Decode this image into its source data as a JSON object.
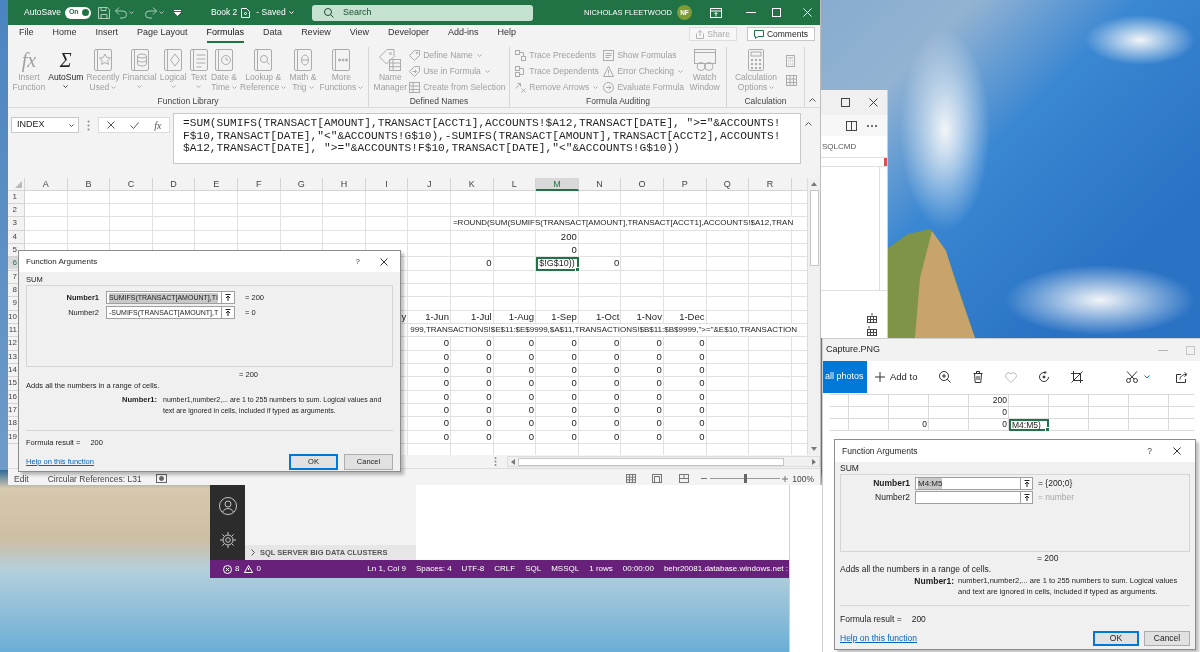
{
  "excel": {
    "title_bar": {
      "autosave_label": "AutoSave",
      "autosave_toggle": {
        "label": "On",
        "on": true
      },
      "document": "Book 2",
      "save_status": "- Saved",
      "search": {
        "placeholder": "Search"
      },
      "user_name": "NICHOLAS FLEETWOOD",
      "user_initials": "NF"
    },
    "tabs": [
      {
        "label": "File",
        "selected": false
      },
      {
        "label": "Home",
        "selected": false
      },
      {
        "label": "Insert",
        "selected": false
      },
      {
        "label": "Page Layout",
        "selected": false
      },
      {
        "label": "Formulas",
        "selected": true
      },
      {
        "label": "Data",
        "selected": false
      },
      {
        "label": "Review",
        "selected": false
      },
      {
        "label": "View",
        "selected": false
      },
      {
        "label": "Developer",
        "selected": false
      },
      {
        "label": "Add-ins",
        "selected": false
      },
      {
        "label": "Help",
        "selected": false
      }
    ],
    "share_button": {
      "label": "Share",
      "disabled": true
    },
    "comments_button": {
      "label": "Comments",
      "disabled": false
    },
    "ribbon_groups": [
      {
        "label": "Function Library",
        "commands": [
          {
            "kind": "large",
            "glyph": "fx",
            "label": "Insert\nFunction",
            "disabled": true,
            "dropdown": false
          },
          {
            "kind": "large",
            "glyph": "Σ",
            "label": "AutoSum",
            "disabled": false,
            "dropdown": true
          },
          {
            "kind": "large",
            "label": "Recently\nUsed",
            "disabled": true,
            "dropdown": true
          },
          {
            "kind": "large",
            "label": "Financial",
            "disabled": true,
            "dropdown": true
          },
          {
            "kind": "large",
            "label": "Logical",
            "disabled": true,
            "dropdown": true
          },
          {
            "kind": "large",
            "label": "Text",
            "disabled": true,
            "dropdown": true
          },
          {
            "kind": "large",
            "label": "Date &\nTime",
            "disabled": true,
            "dropdown": true
          },
          {
            "kind": "large",
            "label": "Lookup &\nReference",
            "disabled": true,
            "dropdown": true
          },
          {
            "kind": "large",
            "label": "Math &\nTrig",
            "disabled": true,
            "dropdown": true
          },
          {
            "kind": "large",
            "label": "More\nFunctions",
            "disabled": true,
            "dropdown": true
          }
        ]
      },
      {
        "label": "Defined Names",
        "commands": [
          {
            "kind": "large",
            "label": "Name\nManager",
            "disabled": true,
            "dropdown": false
          },
          {
            "kind": "small",
            "label": "Define Name",
            "disabled": true,
            "dropdown": true
          },
          {
            "kind": "small",
            "label": "Use in Formula",
            "disabled": true,
            "dropdown": true
          },
          {
            "kind": "small",
            "label": "Create from Selection",
            "disabled": true,
            "dropdown": false
          }
        ]
      },
      {
        "label": "Formula Auditing",
        "commands": [
          {
            "kind": "small",
            "label": "Trace Precedents",
            "disabled": true,
            "dropdown": false
          },
          {
            "kind": "small",
            "label": "Trace Dependents",
            "disabled": true,
            "dropdown": false
          },
          {
            "kind": "small",
            "label": "Remove Arrows",
            "disabled": true,
            "dropdown": true
          },
          {
            "kind": "small",
            "label": "Show Formulas",
            "disabled": true,
            "dropdown": false
          },
          {
            "kind": "small",
            "label": "Error Checking",
            "disabled": true,
            "dropdown": true
          },
          {
            "kind": "small",
            "label": "Evaluate Formula",
            "disabled": true,
            "dropdown": false
          },
          {
            "kind": "large",
            "label": "Watch\nWindow",
            "disabled": true,
            "dropdown": false
          }
        ]
      },
      {
        "label": "Calculation",
        "commands": [
          {
            "kind": "large",
            "label": "Calculation\nOptions",
            "disabled": true,
            "dropdown": true
          },
          {
            "kind": "icon",
            "disabled": true
          },
          {
            "kind": "icon",
            "disabled": true
          }
        ]
      }
    ],
    "formula_bar": {
      "name_box": "INDEX",
      "function_glyph": "fx",
      "formula_lines": [
        "=SUM(SUMIFS(TRANSACT[AMOUNT],TRANSACT[ACCT1],ACCOUNTS!$A12,TRANSACT[DATE], \">=\"&ACCOUNTS!",
        "F$10,TRANSACT[DATE],\"<\"&ACCOUNTS!G$10),-SUMIFS(TRANSACT[AMOUNT],TRANSACT[ACCT2],ACCOUNTS!",
        "$A12,TRANSACT[DATE], \">=\"&ACCOUNTS!F$10,TRANSACT[DATE],\"<\"&ACCOUNTS!G$10))"
      ]
    },
    "grid": {
      "columns": [
        "A",
        "B",
        "C",
        "D",
        "E",
        "F",
        "G",
        "H",
        "I",
        "J",
        "K",
        "L",
        "M",
        "N",
        "O",
        "P",
        "Q",
        "R"
      ],
      "rows": [
        {
          "header": "1"
        },
        {
          "header": "2"
        },
        {
          "header": "3",
          "cells": [
            null,
            null,
            null,
            null,
            null,
            null,
            null,
            null,
            null,
            null,
            {
              "kind": "text",
              "text": "=ROUND(SUM(SUMIFS(TRANSACT[AMOUNT],TRANSACT[ACCT1],ACCOUNTS!$A12,TRAN",
              "selected": false
            },
            null,
            null,
            null,
            null,
            null,
            null,
            null
          ]
        },
        {
          "header": "4",
          "cells": [
            null,
            null,
            null,
            null,
            null,
            null,
            null,
            null,
            null,
            null,
            null,
            null,
            {
              "kind": "number",
              "text": "200",
              "selected": false
            },
            null,
            null,
            null,
            null,
            null
          ]
        },
        {
          "header": "5",
          "cells": [
            null,
            null,
            null,
            null,
            null,
            null,
            null,
            null,
            null,
            null,
            null,
            null,
            {
              "kind": "number",
              "text": "0",
              "selected": false
            },
            null,
            null,
            null,
            null,
            null
          ]
        },
        {
          "header": "6",
          "cells": [
            null,
            null,
            null,
            null,
            null,
            null,
            null,
            null,
            null,
            null,
            {
              "kind": "number",
              "text": "0",
              "selected": false
            },
            null,
            {
              "kind": "text",
              "text": "$!G$10))",
              "selected": true
            },
            {
              "kind": "number",
              "text": "0",
              "selected": false
            },
            null,
            null,
            null,
            null
          ]
        },
        {
          "header": "7"
        },
        {
          "header": "8"
        },
        {
          "header": "9"
        },
        {
          "header": "10",
          "cells": [
            null,
            null,
            null,
            null,
            null,
            null,
            null,
            null,
            {
              "kind": "number",
              "text": "y",
              "selected": false
            },
            {
              "kind": "number",
              "text": "1-Jun",
              "selected": false
            },
            {
              "kind": "number",
              "text": "1-Jul",
              "selected": false
            },
            {
              "kind": "number",
              "text": "1-Aug",
              "selected": false
            },
            {
              "kind": "number",
              "text": "1-Sep",
              "selected": false
            },
            {
              "kind": "number",
              "text": "1-Oct",
              "selected": false
            },
            {
              "kind": "number",
              "text": "1-Nov",
              "selected": false
            },
            {
              "kind": "number",
              "text": "1-Dec",
              "selected": false
            },
            null,
            null
          ]
        },
        {
          "header": "11",
          "cells": [
            null,
            null,
            null,
            null,
            null,
            null,
            null,
            null,
            null,
            {
              "kind": "text",
              "text": "999,TRANSACTIONS!$E$11:$E$9999,$A$11,TRANSACTIONS!$B$11:$B$9999,\">=\"&E$10,TRANSACTION",
              "selected": false
            },
            null,
            null,
            null,
            null,
            null,
            null,
            null,
            null
          ]
        },
        {
          "header": "12",
          "cells": [
            null,
            null,
            null,
            null,
            null,
            null,
            null,
            null,
            null,
            {
              "kind": "number",
              "text": "0",
              "selected": false
            },
            {
              "kind": "number",
              "text": "0",
              "selected": false
            },
            {
              "kind": "number",
              "text": "0",
              "selected": false
            },
            {
              "kind": "number",
              "text": "0",
              "selected": false
            },
            {
              "kind": "number",
              "text": "0",
              "selected": false
            },
            {
              "kind": "number",
              "text": "0",
              "selected": false
            },
            {
              "kind": "number",
              "text": "0",
              "selected": false
            },
            null,
            null
          ]
        },
        {
          "header": "13",
          "cells": [
            null,
            null,
            null,
            null,
            null,
            null,
            null,
            null,
            null,
            {
              "kind": "number",
              "text": "0",
              "selected": false
            },
            {
              "kind": "number",
              "text": "0",
              "selected": false
            },
            {
              "kind": "number",
              "text": "0",
              "selected": false
            },
            {
              "kind": "number",
              "text": "0",
              "selected": false
            },
            {
              "kind": "number",
              "text": "0",
              "selected": false
            },
            {
              "kind": "number",
              "text": "0",
              "selected": false
            },
            {
              "kind": "number",
              "text": "0",
              "selected": false
            },
            null,
            null
          ]
        },
        {
          "header": "14",
          "cells": [
            null,
            null,
            null,
            null,
            null,
            null,
            null,
            null,
            null,
            {
              "kind": "number",
              "text": "0",
              "selected": false
            },
            {
              "kind": "number",
              "text": "0",
              "selected": false
            },
            {
              "kind": "number",
              "text": "0",
              "selected": false
            },
            {
              "kind": "number",
              "text": "0",
              "selected": false
            },
            {
              "kind": "number",
              "text": "0",
              "selected": false
            },
            {
              "kind": "number",
              "text": "0",
              "selected": false
            },
            {
              "kind": "number",
              "text": "0",
              "selected": false
            },
            null,
            null
          ]
        },
        {
          "header": "15",
          "cells": [
            null,
            null,
            null,
            null,
            null,
            null,
            null,
            null,
            null,
            {
              "kind": "number",
              "text": "0",
              "selected": false
            },
            {
              "kind": "number",
              "text": "0",
              "selected": false
            },
            {
              "kind": "number",
              "text": "0",
              "selected": false
            },
            {
              "kind": "number",
              "text": "0",
              "selected": false
            },
            {
              "kind": "number",
              "text": "0",
              "selected": false
            },
            {
              "kind": "number",
              "text": "0",
              "selected": false
            },
            {
              "kind": "number",
              "text": "0",
              "selected": false
            },
            null,
            null
          ]
        },
        {
          "header": "16",
          "cells": [
            null,
            null,
            null,
            null,
            null,
            null,
            null,
            null,
            null,
            {
              "kind": "number",
              "text": "0",
              "selected": false
            },
            {
              "kind": "number",
              "text": "0",
              "selected": false
            },
            {
              "kind": "number",
              "text": "0",
              "selected": false
            },
            {
              "kind": "number",
              "text": "0",
              "selected": false
            },
            {
              "kind": "number",
              "text": "0",
              "selected": false
            },
            {
              "kind": "number",
              "text": "0",
              "selected": false
            },
            {
              "kind": "number",
              "text": "0",
              "selected": false
            },
            null,
            null
          ]
        },
        {
          "header": "17",
          "cells": [
            null,
            null,
            null,
            null,
            null,
            null,
            null,
            null,
            null,
            {
              "kind": "number",
              "text": "0",
              "selected": false
            },
            {
              "kind": "number",
              "text": "0",
              "selected": false
            },
            {
              "kind": "number",
              "text": "0",
              "selected": false
            },
            {
              "kind": "number",
              "text": "0",
              "selected": false
            },
            {
              "kind": "number",
              "text": "0",
              "selected": false
            },
            {
              "kind": "number",
              "text": "0",
              "selected": false
            },
            {
              "kind": "number",
              "text": "0",
              "selected": false
            },
            null,
            null
          ]
        },
        {
          "header": "18",
          "cells": [
            null,
            null,
            null,
            null,
            null,
            null,
            null,
            null,
            null,
            {
              "kind": "number",
              "text": "0",
              "selected": false
            },
            {
              "kind": "number",
              "text": "0",
              "selected": false
            },
            {
              "kind": "number",
              "text": "0",
              "selected": false
            },
            {
              "kind": "number",
              "text": "0",
              "selected": false
            },
            {
              "kind": "number",
              "text": "0",
              "selected": false
            },
            {
              "kind": "number",
              "text": "0",
              "selected": false
            },
            {
              "kind": "number",
              "text": "0",
              "selected": false
            },
            null,
            null
          ]
        },
        {
          "header": "19",
          "cells": [
            null,
            null,
            null,
            null,
            null,
            null,
            null,
            null,
            null,
            {
              "kind": "number",
              "text": "0",
              "selected": false
            },
            {
              "kind": "number",
              "text": "0",
              "selected": false
            },
            {
              "kind": "number",
              "text": "0",
              "selected": false
            },
            {
              "kind": "number",
              "text": "0",
              "selected": false
            },
            {
              "kind": "number",
              "text": "0",
              "selected": false
            },
            {
              "kind": "number",
              "text": "0",
              "selected": false
            },
            {
              "kind": "number",
              "text": "0",
              "selected": false
            },
            null,
            null
          ]
        }
      ]
    },
    "status_bar": {
      "mode": "Edit",
      "circular_references": "Circular References: L31",
      "zoom": {
        "level": 0.5,
        "reading": "100%"
      }
    },
    "dialog": {
      "title": "Function Arguments",
      "help_button": "?",
      "function_name": "SUM",
      "arguments": [
        {
          "label": "Number1",
          "value": "SUMIFS(TRANSACT[AMOUNT],TI",
          "result": "= 200",
          "focused": true,
          "muted": false
        },
        {
          "label": "Number2",
          "value": "-SUMIFS(TRANSACT[AMOUNT],T",
          "result": "= 0",
          "focused": false,
          "muted": false
        }
      ],
      "total": "= 200",
      "description": "Adds all the numbers in a range of cells.",
      "argument_label": "Number1:",
      "argument_help": "number1,number2,... are 1 to 255 numbers to sum. Logical values and text are ignored in cells, included if typed as arguments.",
      "result_label": "Formula result =",
      "result_value": "200",
      "help_link": "Help on this function",
      "buttons": [
        {
          "label": "OK",
          "default": true
        },
        {
          "label": "Cancel",
          "default": false
        }
      ]
    }
  },
  "editor_panel": {
    "toolbar_label": "SQLCMD"
  },
  "data_studio": {
    "section_header": "SQL SERVER BIG DATA CLUSTERS",
    "status_bar": {
      "errors": "8",
      "warnings": "0",
      "items": [
        "Ln 1, Col 9",
        "Spaces: 4",
        "UTF-8",
        "CRLF",
        "SQL",
        "MSSQL",
        "1 rows",
        "00:00:00",
        "behr20081.database.windows.net :"
      ]
    }
  },
  "photos": {
    "title": "Capture.PNG",
    "see_all_button": "all photos",
    "add_to_button": "Add to",
    "image": {
      "grid": {
        "rows": [
          {
            "cells": [
              null,
              null,
              null,
              null,
              {
                "kind": "number",
                "text": "200",
                "selected": false
              },
              null,
              null,
              null,
              null,
              null
            ]
          },
          {
            "cells": [
              null,
              null,
              null,
              null,
              {
                "kind": "number",
                "text": "0",
                "selected": false
              },
              null,
              null,
              null,
              null,
              null
            ]
          },
          {
            "cells": [
              null,
              null,
              {
                "kind": "number",
                "text": "0",
                "selected": false
              },
              null,
              {
                "kind": "number",
                "text": "0",
                "selected": false
              },
              {
                "kind": "text",
                "text": "M4:M5)",
                "selected": true
              },
              null,
              null,
              null,
              null
            ]
          }
        ]
      },
      "dialog": {
        "title": "Function Arguments",
        "help_button": "?",
        "function_name": "SUM",
        "arguments": [
          {
            "label": "Number1",
            "value": "M4:M5",
            "result": "= {200;0}",
            "focused": true,
            "muted": false
          },
          {
            "label": "Number2",
            "result": "= number",
            "focused": false,
            "muted": true
          }
        ],
        "total": "= 200",
        "description": "Adds all the numbers in a range of cells.",
        "argument_label": "Number1:",
        "argument_help": "number1,number2,... are 1 to 255 numbers to sum. Logical values and text are ignored in cells, included if typed as arguments.",
        "result_label": "Formula result =",
        "result_value": "200",
        "help_link": "Help on this function",
        "buttons": [
          {
            "label": "OK",
            "default": true
          },
          {
            "label": "Cancel",
            "default": false
          }
        ]
      }
    }
  }
}
